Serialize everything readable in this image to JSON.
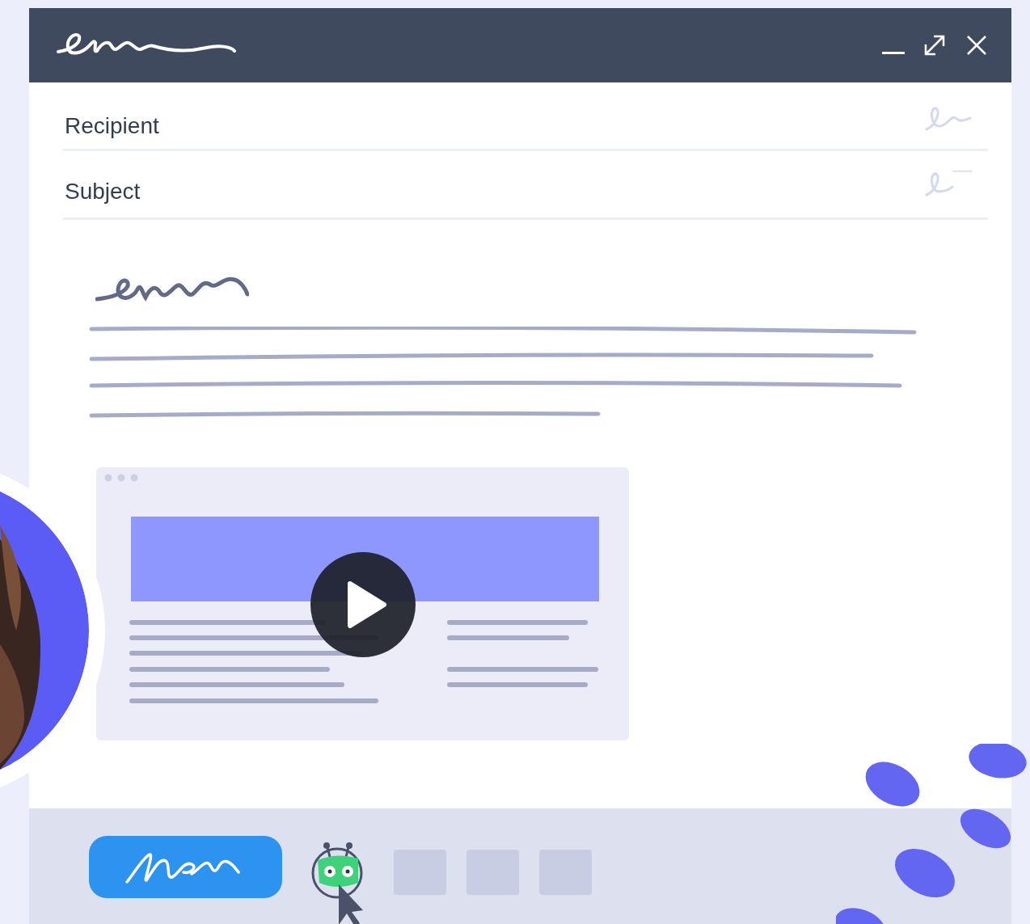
{
  "fields": [
    {
      "placeholder": "Recipient"
    },
    {
      "placeholder": "Subject"
    }
  ]
}
